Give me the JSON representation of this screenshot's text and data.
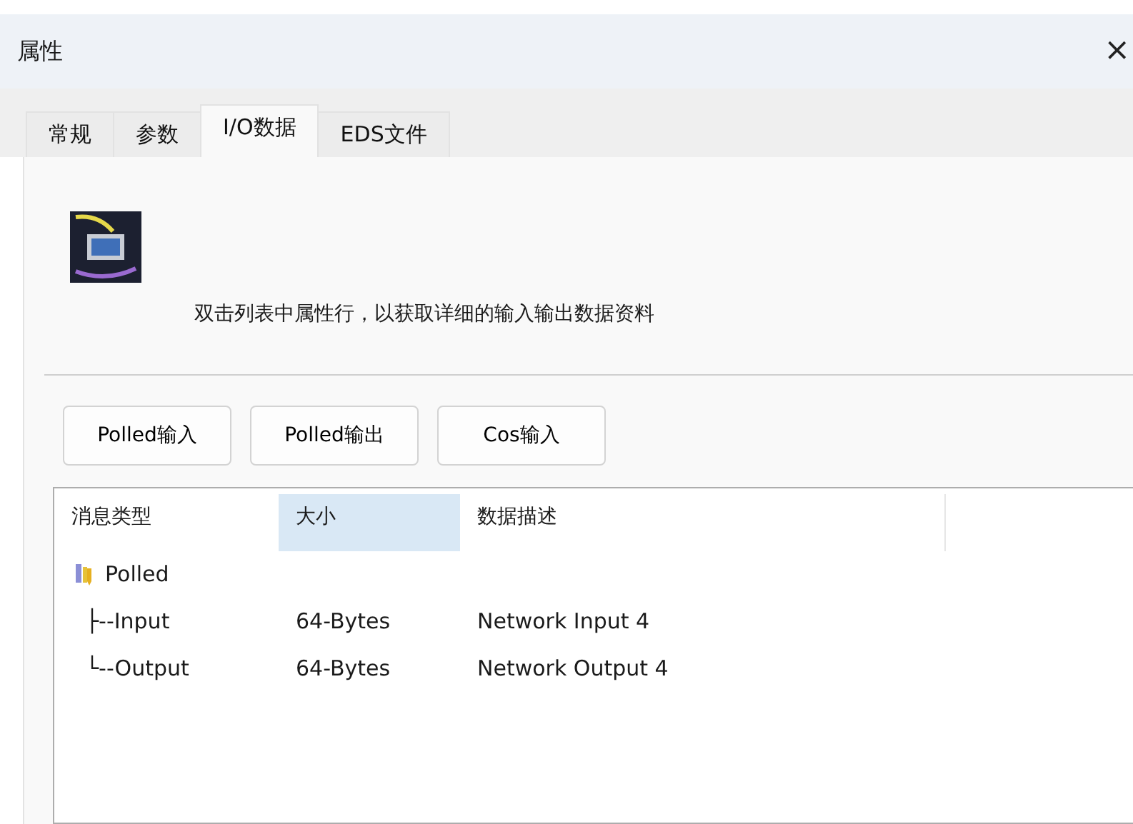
{
  "window": {
    "title": "属性",
    "close": "×"
  },
  "tabs": [
    {
      "label": "常规",
      "selected": false
    },
    {
      "label": "参数",
      "selected": false
    },
    {
      "label": "I/O数据",
      "selected": true
    },
    {
      "label": "EDS文件",
      "selected": false
    }
  ],
  "hint": "双击列表中属性行，以获取详细的输入输出数据资料",
  "buttons": [
    "Polled输入",
    "Polled输出",
    "Cos输入"
  ],
  "table": {
    "columns": [
      {
        "label": "消息类型",
        "selected": false
      },
      {
        "label": "大小",
        "selected": true
      },
      {
        "label": "数据描述",
        "selected": false
      }
    ],
    "rows": [
      {
        "label": "Polled",
        "children": [
          {
            "label": "├--Input",
            "size": "64-Bytes",
            "description": "Network Input 4"
          },
          {
            "label": "└--Output",
            "size": "64-Bytes",
            "description": "Network Output 4"
          }
        ]
      }
    ]
  }
}
